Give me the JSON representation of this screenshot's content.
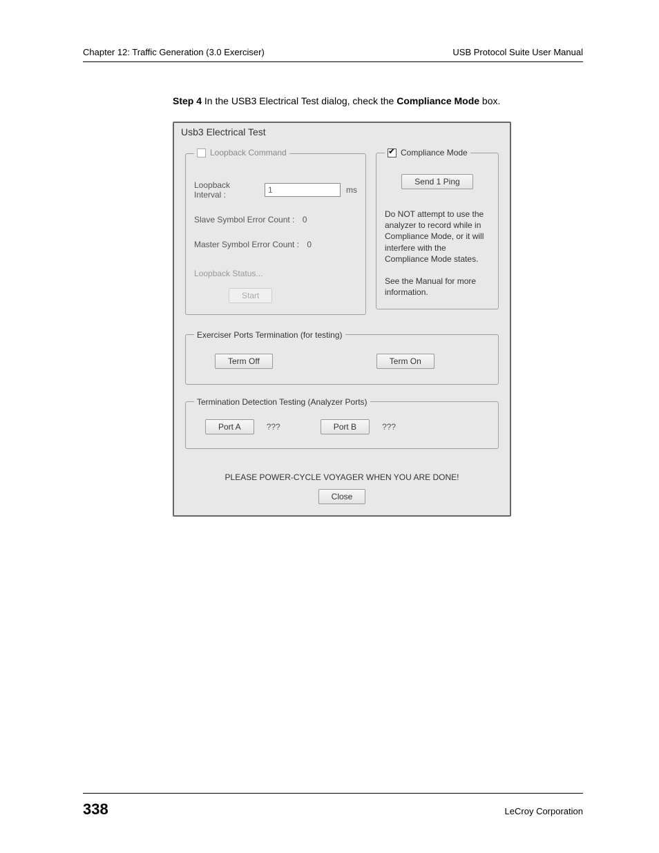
{
  "header": {
    "left": "Chapter 12: Traffic Generation (3.0 Exerciser)",
    "right": "USB Protocol Suite User Manual"
  },
  "step": {
    "label": "Step 4",
    "text_before": "  In the USB3 Electrical Test dialog, check the ",
    "bold": "Compliance Mode",
    "text_after": " box."
  },
  "dialog": {
    "title": "Usb3 Electrical Test",
    "loopback": {
      "legend": "Loopback Command",
      "interval_label": "Loopback Interval :",
      "interval_value": "1",
      "interval_unit": "ms",
      "slave_label": "Slave Symbol Error Count :",
      "slave_value": "0",
      "master_label": "Master Symbol Error Count :",
      "master_value": "0",
      "status": "Loopback Status...",
      "start": "Start"
    },
    "compliance": {
      "legend": "Compliance Mode",
      "send_ping": "Send 1 Ping",
      "warn1": "Do NOT attempt to use the analyzer to record while in Compliance Mode, or it will interfere with the Compliance Mode states.",
      "warn2": "See the Manual for more information."
    },
    "term": {
      "legend": "Exerciser Ports Termination (for testing)",
      "off": "Term Off",
      "on": "Term On"
    },
    "detect": {
      "legend": "Termination Detection Testing (Analyzer Ports)",
      "portA": "Port A",
      "valA": "???",
      "portB": "Port B",
      "valB": "???"
    },
    "bottom_msg": "PLEASE POWER-CYCLE VOYAGER WHEN YOU ARE DONE!",
    "close": "Close"
  },
  "footer": {
    "page": "338",
    "corp": "LeCroy Corporation"
  }
}
